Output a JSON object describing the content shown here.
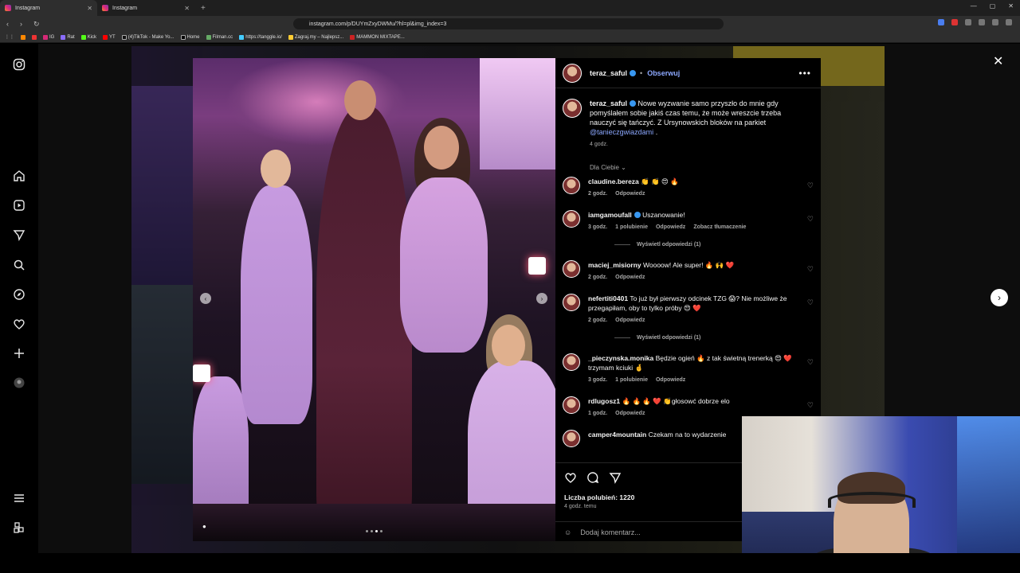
{
  "browser": {
    "tabs": [
      {
        "label": "Instagram",
        "active": true
      },
      {
        "label": "Instagram",
        "active": false
      }
    ],
    "url": "instagram.com/p/DUYmZxyDWMu/?hl=pl&img_index=3",
    "bookmarks": [
      "IG",
      "Rat",
      "Kick",
      "YT",
      "(4)TikTok - Make Yo...",
      "Home",
      "Filman.cc",
      "https://tanggle.io/",
      "Zagraj.my – Najlepsz...",
      "MAMMON MIXTAPE..."
    ]
  },
  "post": {
    "author": "teraz_saful",
    "follow_label": "Obserwuj",
    "more_label": "•••",
    "caption": "Nowe wyzwanie samo przyszło do mnie gdy pomyślałem sobie jakiś czas temu, że może wreszcie trzeba nauczyć się tańczyć. Z Ursynowskich bloków na parkiet",
    "caption_link": "@tanieczgwiazdami",
    "caption_end": ".",
    "caption_time": "4 godz.",
    "filter_label": "Dla Ciebie ⌄",
    "likes": "Liczba polubień: 1220",
    "ago": "4 godz. temu",
    "add_comment_placeholder": "Dodaj komentarz..."
  },
  "comments": [
    {
      "user": "claudine.bereza",
      "verified": false,
      "text": "👏 👏 😍 🔥",
      "time": "2 godz.",
      "likes": "",
      "reply": "Odpowiedz",
      "translate": "",
      "view_replies": ""
    },
    {
      "user": "iamgamoufall",
      "verified": true,
      "text": "Uszanowanie!",
      "time": "3 godz.",
      "likes": "1 polubienie",
      "reply": "Odpowiedz",
      "translate": "Zobacz tłumaczenie",
      "view_replies": "Wyświetl odpowiedzi (1)"
    },
    {
      "user": "maciej_misiorny",
      "verified": false,
      "text": "Woooow! Ale super! 🔥 🙌 ❤️",
      "time": "2 godz.",
      "likes": "",
      "reply": "Odpowiedz",
      "translate": "",
      "view_replies": ""
    },
    {
      "user": "nefertiti0401",
      "verified": false,
      "text": "To już był pierwszy odcinek TZG 😱? Nie możliwe że przegapiłam, oby to tylko próby 😍 ❤️",
      "time": "2 godz.",
      "likes": "",
      "reply": "Odpowiedz",
      "translate": "",
      "view_replies": "Wyświetl odpowiedzi (1)"
    },
    {
      "user": "_pieczynska.monika",
      "verified": false,
      "text": "Będzie ogień 🔥 z tak świetną trenerką 😍 ❤️ trzymam kciuki 🤞",
      "time": "3 godz.",
      "likes": "1 polubienie",
      "reply": "Odpowiedz",
      "translate": "",
      "view_replies": ""
    },
    {
      "user": "rdlugosz1",
      "verified": false,
      "text": "🔥 🔥 🔥 ❤️ 👏głosowć dobrze elo",
      "time": "1 godz.",
      "likes": "",
      "reply": "Odpowiedz",
      "translate": "",
      "view_replies": ""
    },
    {
      "user": "camper4mountain",
      "verified": false,
      "text": "Czekam na to wydarzenie",
      "time": "",
      "likes": "",
      "reply": "",
      "translate": "",
      "view_replies": ""
    }
  ],
  "icons": {
    "close": "✕",
    "next": "›",
    "prev": "‹",
    "heart": "♡",
    "comment": "◯",
    "share": "▽",
    "emoji": "☺"
  }
}
